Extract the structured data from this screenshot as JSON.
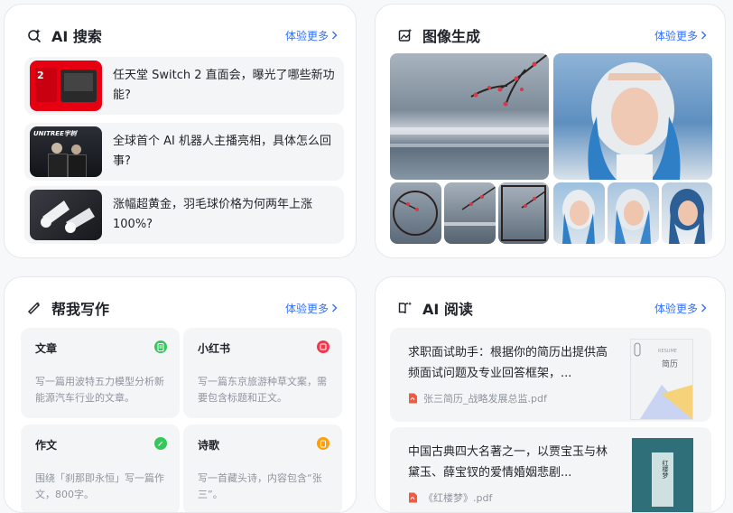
{
  "ai_search": {
    "title": "AI 搜索",
    "more": "体验更多",
    "icon": "ai-search-icon",
    "items": [
      {
        "text": "任天堂 Switch 2 直面会，曝光了哪些新功能?"
      },
      {
        "text": "全球首个 AI 机器人主播亮相，具体怎么回事?",
        "thumb_caption": "UNITREE宇树"
      },
      {
        "text": "涨幅超黄金，羽毛球价格为何两年上涨100%?"
      }
    ]
  },
  "image_gen": {
    "title": "图像生成",
    "more": "体验更多",
    "icon": "image-gen-icon"
  },
  "writing": {
    "title": "帮我写作",
    "more": "体验更多",
    "icon": "writing-icon",
    "tiles": [
      {
        "title": "文章",
        "desc": "写一篇用波特五力模型分析新能源汽车行业的文章。",
        "color": "#34c759",
        "icon": "article-icon"
      },
      {
        "title": "小红书",
        "desc": "写一篇东京旅游种草文案，需要包含标题和正文。",
        "color": "#f5364c",
        "icon": "xiaohongshu-icon"
      },
      {
        "title": "作文",
        "desc": "围绕「刹那即永恒」写一篇作文，800字。",
        "color": "#34c759",
        "icon": "essay-icon"
      },
      {
        "title": "诗歌",
        "desc": "写一首藏头诗，内容包含“张三”。",
        "color": "#ff9f0a",
        "icon": "poem-icon"
      }
    ]
  },
  "ai_reading": {
    "title": "AI 阅读",
    "more": "体验更多",
    "icon": "ai-reading-icon",
    "items": [
      {
        "text": "求职面试助手：根据你的简历出提供高频面试问题及专业回答框架，...",
        "file": "张三简历_战略发展总监.pdf",
        "thumb_label": "简历",
        "thumb_small": "RESUME"
      },
      {
        "text": "中国古典四大名著之一，以贾宝玉与林黛玉、薛宝钗的爱情婚姻悲剧...",
        "file": "《红楼梦》.pdf",
        "thumb_label": "红楼梦"
      }
    ]
  }
}
